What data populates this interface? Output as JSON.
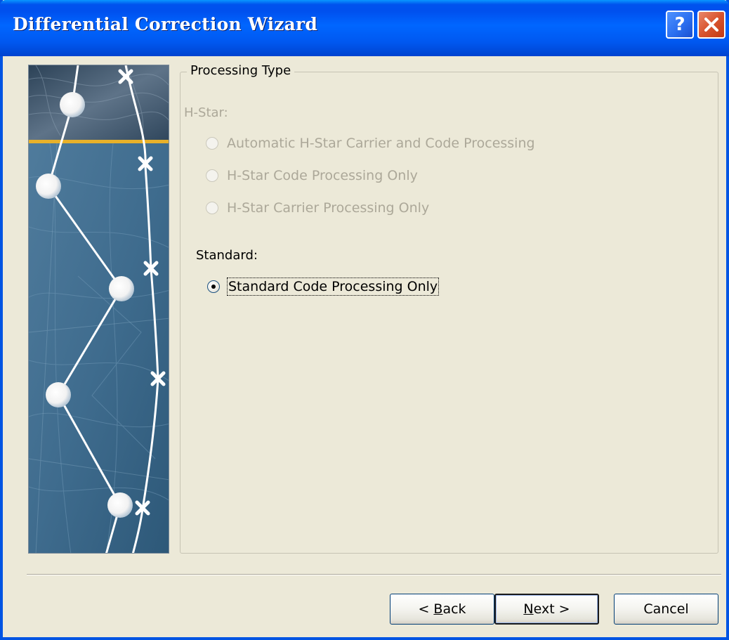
{
  "window": {
    "title": "Differential Correction Wizard",
    "help_label": "?",
    "close_label": "close"
  },
  "group": {
    "legend": "Processing Type"
  },
  "hstar": {
    "label": "H-Star:",
    "options": [
      {
        "label": "Automatic H-Star Carrier and Code Processing",
        "enabled": false,
        "selected": false
      },
      {
        "label": "H-Star Code Processing Only",
        "enabled": false,
        "selected": false
      },
      {
        "label": "H-Star Carrier Processing Only",
        "enabled": false,
        "selected": false
      }
    ]
  },
  "standard": {
    "label": "Standard:",
    "options": [
      {
        "label": "Standard Code Processing Only",
        "enabled": true,
        "selected": true
      }
    ]
  },
  "buttons": {
    "back": {
      "prefix": "< ",
      "mnemonic": "B",
      "rest": "ack"
    },
    "next": {
      "prefix": "",
      "mnemonic": "N",
      "rest": "ext >"
    },
    "cancel": {
      "label": "Cancel"
    }
  },
  "colors": {
    "titlebar": "#0058f0",
    "dialog_bg": "#ece9d8",
    "disabled_text": "#aca899",
    "close_button": "#d9542e"
  }
}
